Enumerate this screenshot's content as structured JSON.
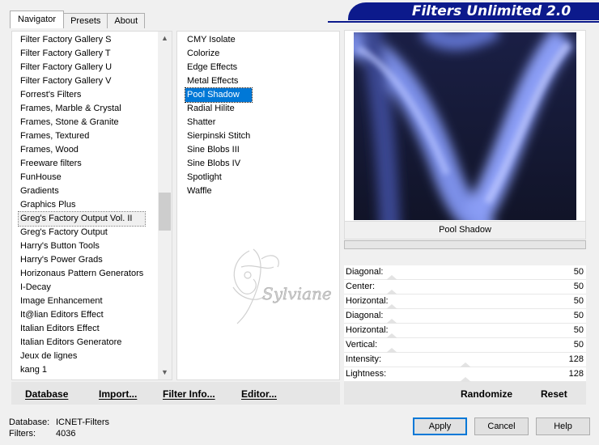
{
  "tabs": [
    "Navigator",
    "Presets",
    "About"
  ],
  "banner": "Filters Unlimited 2.0",
  "categories": [
    "Filter Factory Gallery S",
    "Filter Factory Gallery T",
    "Filter Factory Gallery U",
    "Filter Factory Gallery V",
    "Forrest's Filters",
    "Frames, Marble & Crystal",
    "Frames, Stone & Granite",
    "Frames, Textured",
    "Frames, Wood",
    "Freeware filters",
    "FunHouse",
    "Gradients",
    "Graphics Plus",
    "Greg's Factory Output Vol. II",
    "Greg's Factory Output",
    "Harry's Button Tools",
    "Harry's Power Grads",
    "Horizonaus Pattern Generators",
    "I-Decay",
    "Image Enhancement",
    "It@lian Editors Effect",
    "Italian Editors Effect",
    "Italian Editors Generatore",
    "Jeux de lignes",
    "kang 1"
  ],
  "selected_category": "Greg's Factory Output Vol. II",
  "filters": [
    "CMY Isolate",
    "Colorize",
    "Edge Effects",
    "Metal Effects",
    "Pool Shadow",
    "Radial Hilite",
    "Shatter",
    "Sierpinski Stitch",
    "Sine Blobs III",
    "Sine Blobs IV",
    "Spotlight",
    "Waffle"
  ],
  "selected_filter": "Pool Shadow",
  "filter_name": "Pool Shadow",
  "params": [
    {
      "label": "Diagonal:",
      "value": "50"
    },
    {
      "label": "Center:",
      "value": "50"
    },
    {
      "label": "Horizontal:",
      "value": "50"
    },
    {
      "label": "Diagonal:",
      "value": "50"
    },
    {
      "label": "Horizontal:",
      "value": "50"
    },
    {
      "label": "Vertical:",
      "value": "50"
    },
    {
      "label": "Intensity:",
      "value": "128"
    },
    {
      "label": "Lightness:",
      "value": "128"
    }
  ],
  "toolbar": {
    "database": "Database",
    "import": "Import...",
    "filter_info": "Filter Info...",
    "editor": "Editor...",
    "randomize": "Randomize",
    "reset": "Reset"
  },
  "status": {
    "database_label": "Database:",
    "database_value": "ICNET-Filters",
    "filters_label": "Filters:",
    "filters_value": "4036"
  },
  "buttons": {
    "apply": "Apply",
    "cancel": "Cancel",
    "help": "Help"
  },
  "watermark_text": "Sylviane",
  "colors": {
    "banner": "#0c1a8c",
    "selection": "#0078d7",
    "preview_accent": "#8a9df5"
  }
}
